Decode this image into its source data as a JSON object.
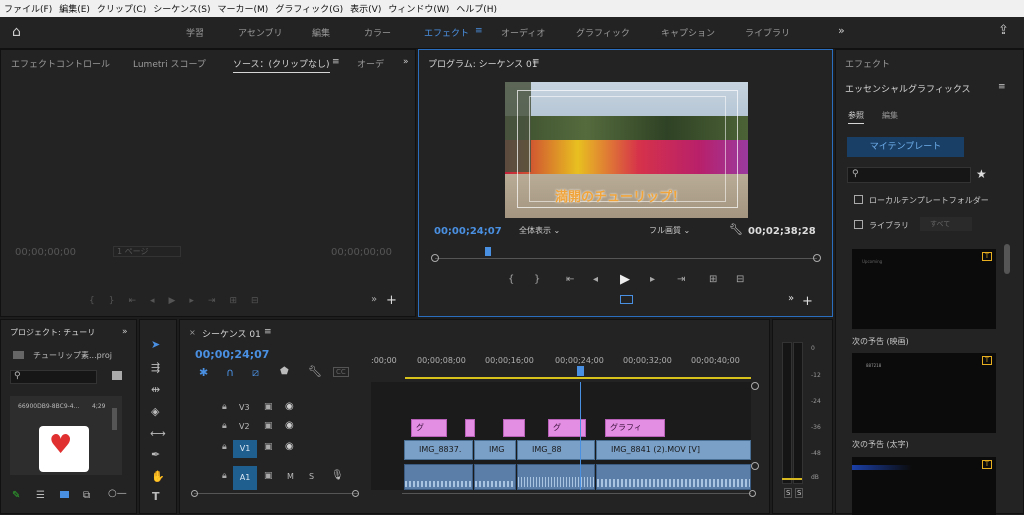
{
  "menu": [
    "ファイル(F)",
    "編集(E)",
    "クリップ(C)",
    "シーケンス(S)",
    "マーカー(M)",
    "グラフィック(G)",
    "表示(V)",
    "ウィンドウ(W)",
    "ヘルプ(H)"
  ],
  "workspaces": [
    "学習",
    "アセンブリ",
    "編集",
    "カラー",
    "エフェクト",
    "オーディオ",
    "グラフィック",
    "キャプション",
    "ライブラリ"
  ],
  "workspace_active": "エフェクト",
  "source_panel": {
    "tabs": [
      "エフェクトコントロール",
      "Lumetri スコープ",
      "ソース：(クリップなし)",
      "オーデ"
    ],
    "tc_in": "00;00;00;00",
    "tc_out": "00;00;00;00",
    "page": "1 ページ"
  },
  "program": {
    "title": "プログラム: シーケンス 01",
    "overlay_text": "満開のチューリップ！",
    "tc_current": "00;00;24;07",
    "zoom": "全体表示",
    "quality": "フル画質",
    "tc_duration": "00;02;38;28"
  },
  "right_panel": {
    "tab1": "エフェクト",
    "title": "エッセンシャルグラフィックス",
    "subtab_browse": "参照",
    "subtab_edit": "編集",
    "my_templates": "マイテンプレート",
    "local_folder": "ローカルテンプレートフォルダー",
    "library": "ライブラリ",
    "library_select": "すべて",
    "templates": [
      {
        "label": "次の予告 (映画)",
        "inner": "Upcoming"
      },
      {
        "label": "次の予告 (太字)",
        "inner": "887218"
      }
    ]
  },
  "project": {
    "title": "プロジェクト: チューリ",
    "file": "チューリップ素...proj",
    "item_name": "66900DB9-8BC9-4...",
    "item_dur": "4;29"
  },
  "timeline": {
    "tab": "シーケンス 01",
    "tc": "00;00;24;07",
    "ruler": [
      ":00;00",
      "00;00;08;00",
      "00;00;16;00",
      "00;00;24;00",
      "00;00;32;00",
      "00;00;40;00"
    ],
    "tracks": [
      "V3",
      "V2",
      "V1",
      "A1"
    ],
    "graphic_clips": [
      "グ",
      "グ",
      "グラフィ"
    ],
    "video_clips": [
      "IMG_8837.",
      "IMG",
      "IMG_88",
      "IMG_8841 (2).MOV [V]"
    ],
    "meter_scale": [
      "0",
      "-12",
      "-24",
      "-36",
      "-48",
      "dB"
    ],
    "solo": [
      "S",
      "S"
    ]
  },
  "colors": {
    "accent": "#4a90e2",
    "graphic_clip": "#e38ee3",
    "video_clip": "#7aa0c8"
  }
}
